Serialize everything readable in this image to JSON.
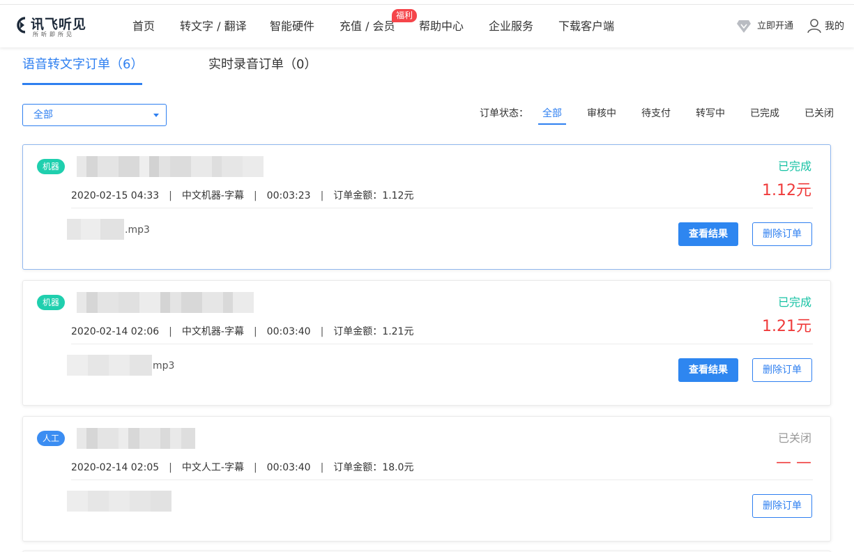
{
  "header": {
    "logo_name": "讯飞听见",
    "logo_slogan": "所听即所见",
    "nav": [
      "首页",
      "转文字 / 翻译",
      "智能硬件",
      "充值 / 会员",
      "帮助中心",
      "企业服务",
      "下载客户端"
    ],
    "promo_badge": "福利",
    "vip_label": "立即开通",
    "user_label": "我的"
  },
  "tabs": [
    {
      "label": "语音转文字订单（6）",
      "active": true
    },
    {
      "label": "实时录音订单（0）",
      "active": false
    }
  ],
  "filter": {
    "selected": "全部"
  },
  "status_filter": {
    "label": "订单状态：",
    "options": [
      "全部",
      "审核中",
      "待支付",
      "转写中",
      "已完成",
      "已关闭"
    ],
    "active": "全部"
  },
  "orders": [
    {
      "type": "机器",
      "date": "2020-02-15 04:33",
      "service": "中文机器-字幕",
      "duration": "00:03:23",
      "amount": "订单金额：1.12元",
      "file_ext": ".mp3",
      "status": "已完成",
      "price": "1.12元",
      "view_button": "查看结果",
      "delete_button": "删除订单"
    },
    {
      "type": "机器",
      "date": "2020-02-14 02:06",
      "service": "中文机器-字幕",
      "duration": "00:03:40",
      "amount": "订单金额：1.21元",
      "file_ext": "mp3",
      "status": "已完成",
      "price": "1.21元",
      "view_button": "查看结果",
      "delete_button": "删除订单"
    },
    {
      "type": "人工",
      "date": "2020-02-14 02:05",
      "service": "中文人工-字幕",
      "duration": "00:03:40",
      "amount": "订单金额：18.0元",
      "file_ext": "",
      "status": "已关闭",
      "price": "— —",
      "delete_button": "删除订单"
    }
  ],
  "colors": {
    "accent": "#2e7ff0",
    "done": "#17c2a4",
    "price": "#ef3a3a",
    "machine_badge": "#1fcfae",
    "human_badge": "#3b8df2",
    "promo": "#f5454a"
  }
}
